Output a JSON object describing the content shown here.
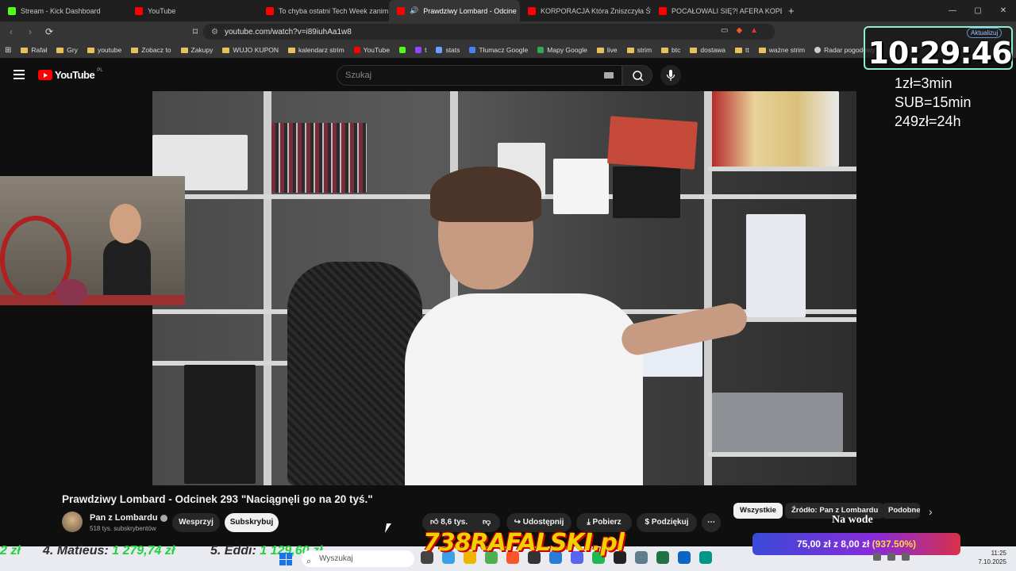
{
  "browser": {
    "tabs": [
      {
        "label": "Stream - Kick Dashboard",
        "color": "#53fc18"
      },
      {
        "label": "YouTube",
        "color": "#ff0000"
      },
      {
        "label": "To chyba ostatni Tech Week zanim ni",
        "color": "#ff0000"
      },
      {
        "label": "Prawdziwy Lombard - Odcine",
        "color": "#ff0000",
        "active": true
      },
      {
        "label": "KORPORACJA Która Zniszczyła Świat",
        "color": "#ff0000"
      },
      {
        "label": "POCAŁOWALI SIĘ?! AFERA KOPERKO",
        "color": "#ff0000"
      }
    ],
    "new_tab": "+",
    "window_controls": [
      "—",
      "▢",
      "✕"
    ],
    "url": "youtube.com/watch?v=i89iuhAa1w8",
    "bookmarks": [
      {
        "label": "Rafał",
        "type": "folder"
      },
      {
        "label": "Gry",
        "type": "folder"
      },
      {
        "label": "youtube",
        "type": "folder"
      },
      {
        "label": "Zobacz to",
        "type": "folder"
      },
      {
        "label": "Zakupy",
        "type": "folder"
      },
      {
        "label": "WUJO KUPON",
        "type": "folder"
      },
      {
        "label": "kalendarz strim",
        "type": "folder"
      },
      {
        "label": "YouTube",
        "type": "icon",
        "color": "#ff0000"
      },
      {
        "label": "",
        "type": "icon",
        "color": "#53fc18"
      },
      {
        "label": "t",
        "type": "icon",
        "color": "#9146ff"
      },
      {
        "label": "stats",
        "type": "icon",
        "color": "#6aa0ff"
      },
      {
        "label": "Tłumacz Google",
        "type": "icon",
        "color": "#4285f4"
      },
      {
        "label": "Mapy Google",
        "type": "icon",
        "color": "#34a853"
      },
      {
        "label": "live",
        "type": "folder"
      },
      {
        "label": "strim",
        "type": "folder"
      },
      {
        "label": "btc",
        "type": "folder"
      },
      {
        "label": "dostawa",
        "type": "folder"
      },
      {
        "label": "tt",
        "type": "folder"
      },
      {
        "label": "ważne strim",
        "type": "folder"
      },
      {
        "label": "Radar pogodowy -",
        "type": "icon",
        "color": "#cccccc"
      }
    ]
  },
  "youtube": {
    "logo_text": "YouTube",
    "logo_region": "PL",
    "search_placeholder": "Szukaj",
    "video": {
      "title": "Prawdziwy Lombard - Odcinek 293 \"Naciągnęli go na 20 tyś.\"",
      "channel": "Pan z Lombardu",
      "subscribers": "518 tys. subskrybentów",
      "support_label": "Wesprzyj",
      "subscribe_label": "Subskrybuj",
      "likes": "8,6 tys.",
      "share_label": "Udostępnij",
      "download_label": "Pobierz",
      "thanks_label": "Podziękuj",
      "more_label": "⋯"
    },
    "chips": [
      "Wszystkie",
      "Źródło: Pan z Lombardu",
      "Podobne"
    ]
  },
  "stream_overlay": {
    "timer": "10:29:46",
    "update_label": "Aktualizuj",
    "rates": [
      "1zł=3min",
      "SUB=15min",
      "249zł=24h"
    ],
    "thumbnail_text": "Na wode",
    "leaderboard": [
      {
        "rank_name": "",
        "amount": "2 zł"
      },
      {
        "rank_name": "4. Matieus:",
        "amount": "1 279,74 zł"
      },
      {
        "rank_name": "5. Eddi:",
        "amount": "1 129,60 zł"
      }
    ],
    "brand": "738RAFALSKI.pl",
    "donation": {
      "text": "75,00 zł z 8,00 zł",
      "percent": "(937.50%)"
    }
  },
  "taskbar": {
    "search_placeholder": "Wyszukaj",
    "time": "11:25",
    "date": "7.10.2025"
  }
}
